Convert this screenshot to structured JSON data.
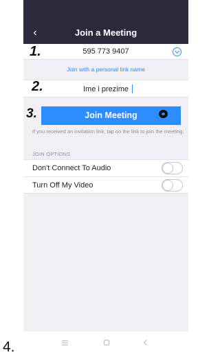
{
  "header": {
    "title": "Join a Meeting",
    "back_icon": "chevron-left-icon"
  },
  "meeting_id": {
    "value": "595 773 9407",
    "dropdown_icon": "chevron-down-circle-icon"
  },
  "personal_link": {
    "label": "Join with a personal link name"
  },
  "name_field": {
    "value": "Ime i prezime"
  },
  "join_button": {
    "label": "Join Meeting"
  },
  "info_text": "If you received an invitation link, tap on the link to join the meeting.",
  "join_options": {
    "section_label": "JOIN OPTIONS",
    "items": [
      {
        "label": "Don't Connect To Audio",
        "on": false
      },
      {
        "label": "Turn Off My Video",
        "on": false
      }
    ]
  },
  "nav_bar": {
    "icons": [
      "menu-icon",
      "home-icon",
      "back-icon"
    ]
  },
  "annotations": {
    "step1": "1.",
    "step2": "2.",
    "step3": "3.",
    "step4": "4."
  },
  "colors": {
    "accent": "#2d8cff",
    "header_bg": "#2a2a3a",
    "page_bg": "#efeff4"
  }
}
